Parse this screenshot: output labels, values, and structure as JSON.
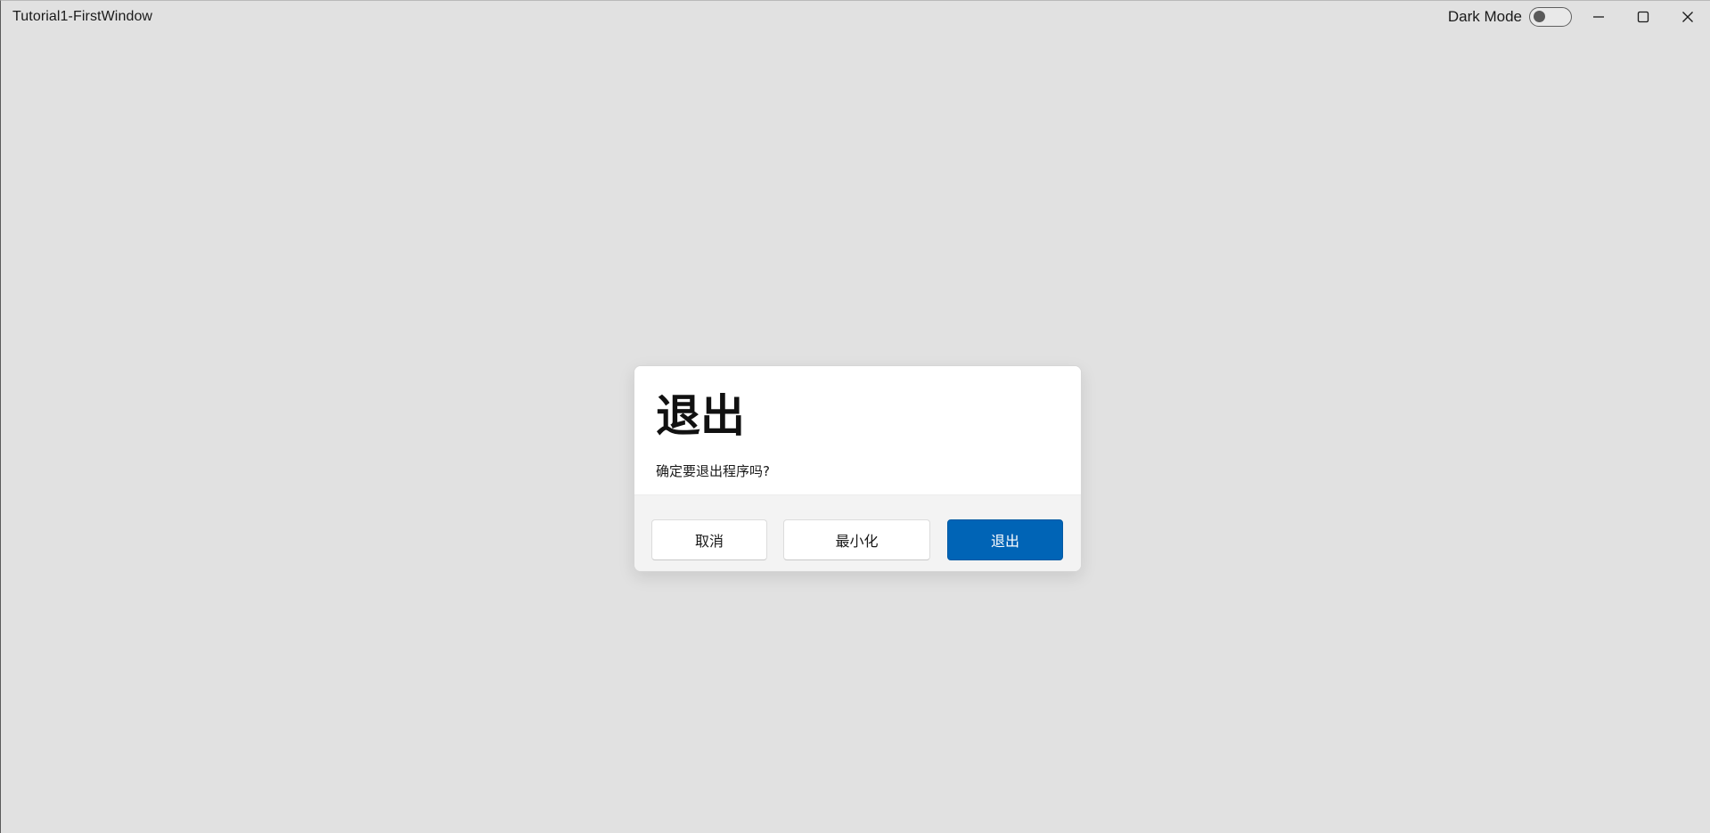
{
  "window": {
    "title": "Tutorial1-FirstWindow"
  },
  "titlebar": {
    "dark_mode_label": "Dark Mode",
    "dark_mode_on": false,
    "caption_icons": [
      "minimize-icon",
      "maximize-icon",
      "close-icon"
    ]
  },
  "dialog": {
    "title": "退出",
    "message": "确定要退出程序吗?",
    "buttons": {
      "cancel": "取消",
      "minimize": "最小化",
      "exit": "退出"
    }
  },
  "colors": {
    "background": "#e1e1e1",
    "accent": "#0064b6",
    "dialog_surface": "#ffffff",
    "dialog_footer": "#f3f3f3"
  }
}
